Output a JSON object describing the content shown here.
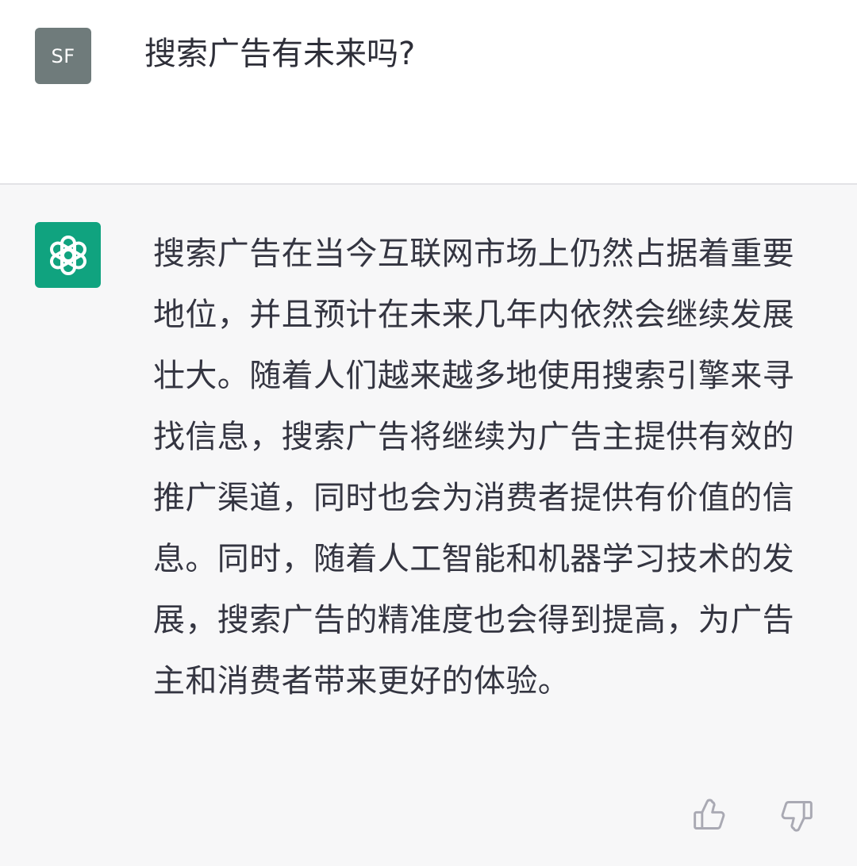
{
  "user_message": {
    "avatar_initials": "SF",
    "text": "搜索广告有未来吗?"
  },
  "assistant_message": {
    "avatar_icon": "openai-logo-icon",
    "text": "搜索广告在当今互联网市场上仍然占据着重要地位，并且预计在未来几年内依然会继续发展壮大。随着人们越来越多地使用搜索引擎来寻找信息，搜索广告将继续为广告主提供有效的推广渠道，同时也会为消费者提供有价值的信息。同时，随着人工智能和机器学习技术的发展，搜索广告的精准度也会得到提高，为广告主和消费者带来更好的体验。"
  },
  "feedback": {
    "thumbs_up_icon": "thumbs-up-icon",
    "thumbs_down_icon": "thumbs-down-icon"
  },
  "colors": {
    "user_background": "#ffffff",
    "assistant_background": "#f7f7f8",
    "user_avatar": "#6f7b7b",
    "assistant_avatar": "#10a37f",
    "text": "#343541",
    "icon": "#a9a9b3"
  }
}
